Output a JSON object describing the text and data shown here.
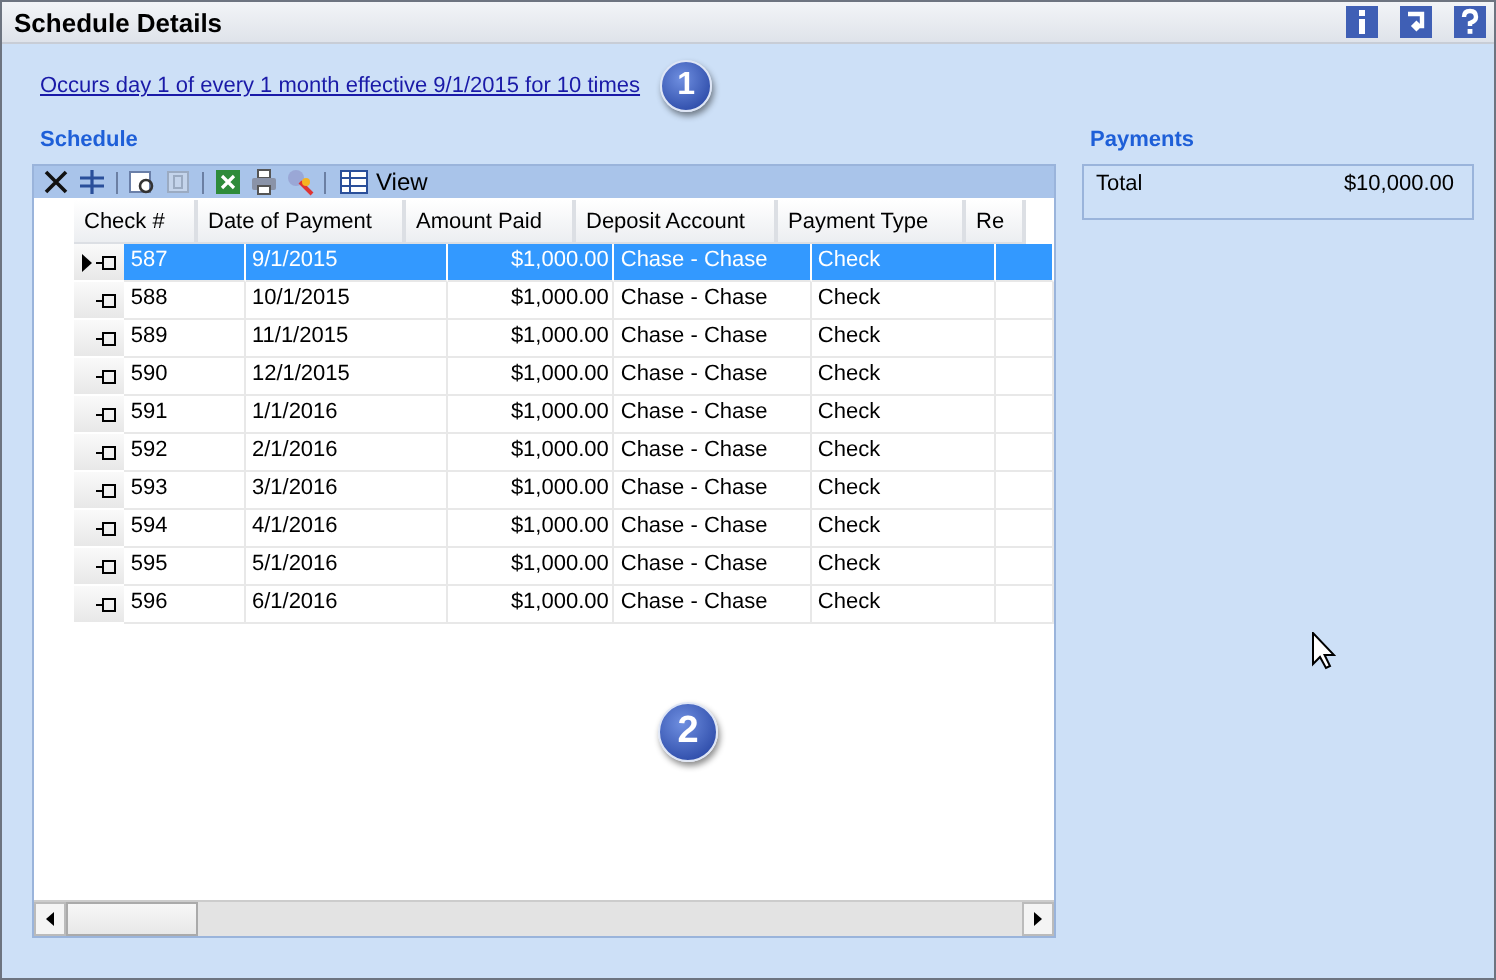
{
  "window": {
    "title": "Schedule Details"
  },
  "header_icons": [
    {
      "kind": "info"
    },
    {
      "kind": "undo"
    },
    {
      "kind": "help"
    }
  ],
  "recurrence_link": "Occurs day 1 of every 1 month effective 9/1/2015 for 10 times",
  "callouts": [
    "1",
    "2"
  ],
  "schedule": {
    "title": "Schedule",
    "toolbar": [
      {
        "kind": "delete",
        "disabled": false
      },
      {
        "kind": "grid",
        "disabled": false
      },
      {
        "kind": "sep"
      },
      {
        "kind": "find",
        "disabled": false
      },
      {
        "kind": "page",
        "disabled": true
      },
      {
        "kind": "sep"
      },
      {
        "kind": "excel",
        "disabled": false
      },
      {
        "kind": "print",
        "disabled": false
      },
      {
        "kind": "chart",
        "disabled": false
      },
      {
        "kind": "sep"
      },
      {
        "kind": "view",
        "label": "View",
        "disabled": false
      }
    ],
    "columns": [
      "Check #",
      "Date of Payment",
      "Amount Paid",
      "Deposit Account",
      "Payment Type",
      "Re"
    ],
    "rows": [
      {
        "selected": true,
        "cells": [
          "587",
          "9/1/2015",
          "$1,000.00",
          "Chase - Chase",
          "Check"
        ]
      },
      {
        "selected": false,
        "cells": [
          "588",
          "10/1/2015",
          "$1,000.00",
          "Chase - Chase",
          "Check"
        ]
      },
      {
        "selected": false,
        "cells": [
          "589",
          "11/1/2015",
          "$1,000.00",
          "Chase - Chase",
          "Check"
        ]
      },
      {
        "selected": false,
        "cells": [
          "590",
          "12/1/2015",
          "$1,000.00",
          "Chase - Chase",
          "Check"
        ]
      },
      {
        "selected": false,
        "cells": [
          "591",
          "1/1/2016",
          "$1,000.00",
          "Chase - Chase",
          "Check"
        ]
      },
      {
        "selected": false,
        "cells": [
          "592",
          "2/1/2016",
          "$1,000.00",
          "Chase - Chase",
          "Check"
        ]
      },
      {
        "selected": false,
        "cells": [
          "593",
          "3/1/2016",
          "$1,000.00",
          "Chase - Chase",
          "Check"
        ]
      },
      {
        "selected": false,
        "cells": [
          "594",
          "4/1/2016",
          "$1,000.00",
          "Chase - Chase",
          "Check"
        ]
      },
      {
        "selected": false,
        "cells": [
          "595",
          "5/1/2016",
          "$1,000.00",
          "Chase - Chase",
          "Check"
        ]
      },
      {
        "selected": false,
        "cells": [
          "596",
          "6/1/2016",
          "$1,000.00",
          "Chase - Chase",
          "Check"
        ]
      }
    ]
  },
  "payments": {
    "title": "Payments",
    "label": "Total",
    "value": "$10,000.00"
  }
}
